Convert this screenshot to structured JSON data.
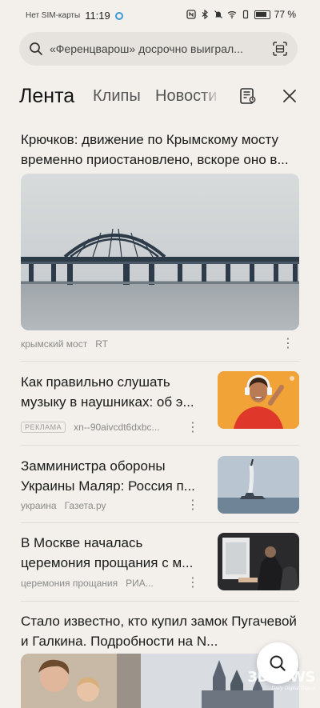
{
  "status_bar": {
    "carrier": "Нет SIM-карты",
    "time": "11:19",
    "battery": "77 %"
  },
  "search": {
    "query": "«Ференцварош» досрочно выиграл..."
  },
  "tabs": [
    {
      "label": "Лента",
      "active": true
    },
    {
      "label": "Клипы",
      "active": false
    },
    {
      "label": "Новости",
      "active": false
    }
  ],
  "feed": [
    {
      "headline": "Крючков: движение по Крымскому мосту временно приостановлено, вскоре оно в...",
      "tag": "крымский мост",
      "source": "RT",
      "image": "crimean-bridge"
    },
    {
      "headline": "Как правильно слушать музыку в наушниках: об э...",
      "badge": "РЕКЛАМА",
      "source": "xn--90aivcdt6dxbc...",
      "image": "woman-headphones"
    },
    {
      "headline": "Замминистра обороны Украины Маляр: Россия п...",
      "tag": "украина",
      "source": "Газета.ру",
      "image": "missile-launch-ship"
    },
    {
      "headline": "В Москве началась церемония прощания с м...",
      "tag": "церемония прощания",
      "source": "РИА...",
      "image": "farewell-ceremony"
    },
    {
      "headline": "Стало известно, кто купил замок Пугачевой и Галкина. Подробности на N...",
      "image": "castle-and-people"
    }
  ],
  "watermark": {
    "brand": "3DNEWS",
    "tagline": "Daily Digital Digest"
  },
  "colors": {
    "background": "#f3f0eb",
    "search_bg": "#e6e3de",
    "accent_blue": "#3a9bd8"
  }
}
